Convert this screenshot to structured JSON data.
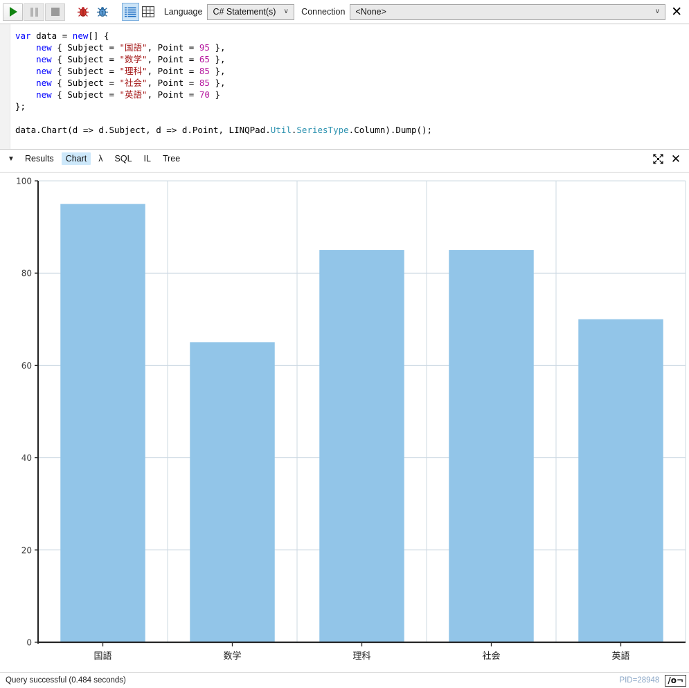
{
  "toolbar": {
    "run_label": "run-button",
    "pause_label": "pause-button",
    "stop_label": "stop-button",
    "debug_label": "debug-button",
    "debug_step_label": "debug-step-button",
    "rows_view_label": "rows-view-toggle",
    "grid_view_label": "grid-view-toggle",
    "language_label": "Language",
    "language_value": "C# Statement(s)",
    "connection_label": "Connection",
    "connection_value": "<None>",
    "close_label": "✕",
    "chevron": "∨"
  },
  "editor": {
    "lines": [
      [
        {
          "t": "var ",
          "c": "kw"
        },
        {
          "t": "data = "
        },
        {
          "t": "new",
          "c": "kw"
        },
        {
          "t": "[] {"
        }
      ],
      [
        {
          "t": "    "
        },
        {
          "t": "new",
          "c": "kw"
        },
        {
          "t": " { Subject = "
        },
        {
          "t": "\"国語\"",
          "c": "str"
        },
        {
          "t": ", Point = "
        },
        {
          "t": "95",
          "c": "num"
        },
        {
          "t": " },"
        }
      ],
      [
        {
          "t": "    "
        },
        {
          "t": "new",
          "c": "kw"
        },
        {
          "t": " { Subject = "
        },
        {
          "t": "\"数学\"",
          "c": "str"
        },
        {
          "t": ", Point = "
        },
        {
          "t": "65",
          "c": "num"
        },
        {
          "t": " },"
        }
      ],
      [
        {
          "t": "    "
        },
        {
          "t": "new",
          "c": "kw"
        },
        {
          "t": " { Subject = "
        },
        {
          "t": "\"理科\"",
          "c": "str"
        },
        {
          "t": ", Point = "
        },
        {
          "t": "85",
          "c": "num"
        },
        {
          "t": " },"
        }
      ],
      [
        {
          "t": "    "
        },
        {
          "t": "new",
          "c": "kw"
        },
        {
          "t": " { Subject = "
        },
        {
          "t": "\"社会\"",
          "c": "str"
        },
        {
          "t": ", Point = "
        },
        {
          "t": "85",
          "c": "num"
        },
        {
          "t": " },"
        }
      ],
      [
        {
          "t": "    "
        },
        {
          "t": "new",
          "c": "kw"
        },
        {
          "t": " { Subject = "
        },
        {
          "t": "\"英語\"",
          "c": "str"
        },
        {
          "t": ", Point = "
        },
        {
          "t": "70",
          "c": "num"
        },
        {
          "t": " }"
        }
      ],
      [
        {
          "t": "};"
        }
      ],
      [
        {
          "t": ""
        }
      ],
      [
        {
          "t": "data.Chart(d => d.Subject, d => d.Point, LINQPad."
        },
        {
          "t": "Util",
          "c": "typ"
        },
        {
          "t": "."
        },
        {
          "t": "SeriesType",
          "c": "typ"
        },
        {
          "t": ".Column).Dump();"
        }
      ]
    ]
  },
  "results": {
    "caret": "▼",
    "tabs": [
      {
        "id": "results",
        "label": "Results",
        "active": false
      },
      {
        "id": "chart",
        "label": "Chart",
        "active": true
      },
      {
        "id": "lambda",
        "label": "λ",
        "active": false
      },
      {
        "id": "sql",
        "label": "SQL",
        "active": false
      },
      {
        "id": "il",
        "label": "IL",
        "active": false
      },
      {
        "id": "tree",
        "label": "Tree",
        "active": false
      }
    ],
    "expand_icon": "expand-results-icon",
    "close_label": "✕"
  },
  "chart_data": {
    "type": "bar",
    "title": "",
    "xlabel": "",
    "ylabel": "",
    "categories": [
      "国語",
      "数学",
      "理科",
      "社会",
      "英語"
    ],
    "values": [
      95,
      65,
      85,
      85,
      70
    ],
    "series": [
      {
        "name": "Point",
        "values": [
          95,
          65,
          85,
          85,
          70
        ]
      }
    ],
    "ylim": [
      0,
      100
    ],
    "yticks": [
      0,
      20,
      40,
      60,
      80,
      100
    ],
    "grid": {
      "horizontal": true,
      "vertical": true
    },
    "legend": "none",
    "bar_color": "#92c5e8",
    "grid_color": "#ccd8e2",
    "axis_color": "#262626"
  },
  "statusbar": {
    "message": "Query successful  (0.484 seconds)",
    "pid": "PID=28948",
    "key_icon_label": "/o¬"
  }
}
